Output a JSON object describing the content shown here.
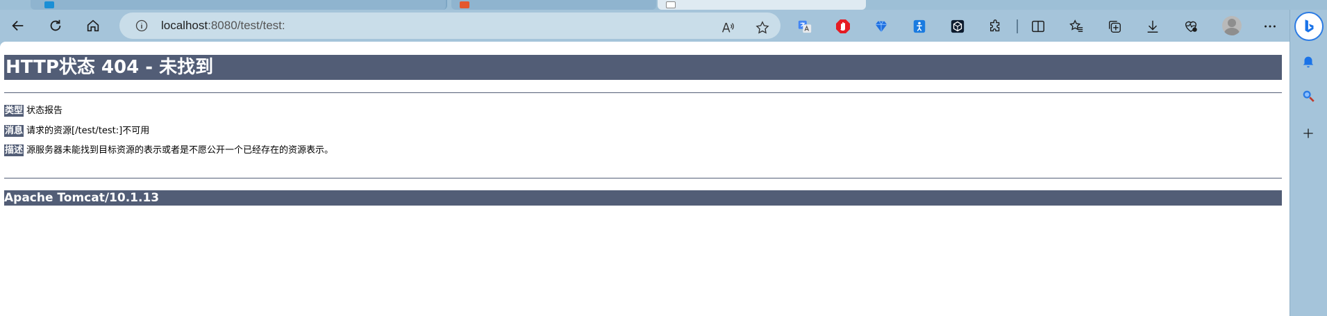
{
  "browser": {
    "address": {
      "host": "localhost",
      "path": ":8080/test/test:"
    },
    "colors": {
      "frame": "#a5c4da",
      "address_bg": "#c9dde9",
      "accent": "#2b7be4"
    },
    "toolbar_icons": [
      "back-icon",
      "refresh-icon",
      "home-icon",
      "info-icon",
      "read-aloud-icon",
      "favorite-star-icon"
    ],
    "extensions": [
      "translate-extension-icon",
      "adblock-extension-icon",
      "diamond-extension-icon",
      "accessibility-extension-icon",
      "cube-extension-icon",
      "puzzle-extensions-icon",
      "split-screen-icon",
      "favorites-icon",
      "collections-icon",
      "downloads-icon",
      "browser-essentials-icon",
      "profile-avatar",
      "more-menu-icon"
    ],
    "sidebar_icons": [
      "bing-copilot-icon",
      "bell-icon",
      "search-icon",
      "add-icon"
    ]
  },
  "page": {
    "title": "HTTP状态 404 - 未找到",
    "rows": [
      {
        "label": "类型",
        "value": "状态报告"
      },
      {
        "label": "消息",
        "value": "请求的资源[/test/test:]不可用"
      },
      {
        "label": "描述",
        "value": "源服务器未能找到目标资源的表示或者是不愿公开一个已经存在的资源表示。"
      }
    ],
    "footer": "Apache Tomcat/10.1.13",
    "colors": {
      "header_bg": "#525d76",
      "header_text": "#ffffff"
    }
  }
}
